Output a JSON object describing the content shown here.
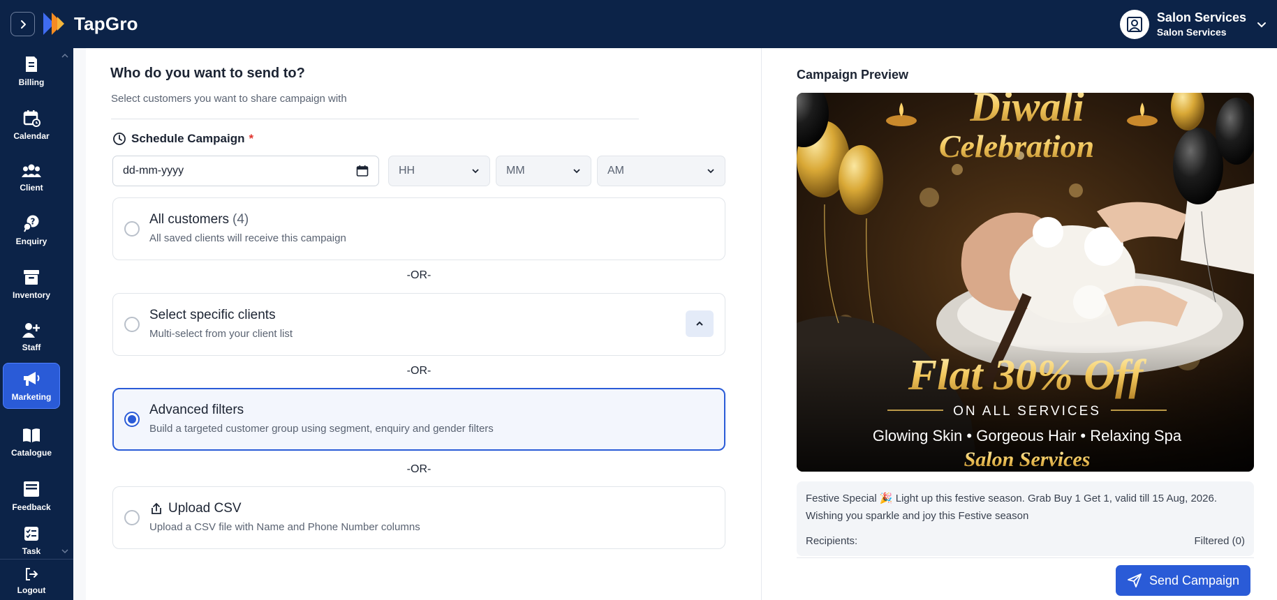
{
  "app": {
    "name": "TapGro"
  },
  "profile": {
    "name": "Salon Services",
    "subtitle": "Salon Services"
  },
  "sidebar": {
    "items": [
      {
        "label": "Billing",
        "icon": "receipt-icon",
        "active": false
      },
      {
        "label": "Calendar",
        "icon": "calendar-icon",
        "active": false
      },
      {
        "label": "Client",
        "icon": "users-icon",
        "active": false
      },
      {
        "label": "Enquiry",
        "icon": "question-chat-icon",
        "active": false
      },
      {
        "label": "Inventory",
        "icon": "archive-box-icon",
        "active": false
      },
      {
        "label": "Staff",
        "icon": "add-user-icon",
        "active": false
      },
      {
        "label": "Marketing",
        "icon": "megaphone-icon",
        "active": true
      },
      {
        "label": "Catalogue",
        "icon": "open-book-icon",
        "active": false
      },
      {
        "label": "Feedback",
        "icon": "inbox-icon",
        "active": false
      },
      {
        "label": "Task",
        "icon": "checklist-icon",
        "active": false
      }
    ],
    "logout_label": "Logout"
  },
  "audience": {
    "title": "Who do you want to send to?",
    "subtitle": "Select customers you want to share campaign with",
    "schedule_label": "Schedule Campaign",
    "required_mark": "*",
    "date_placeholder": "dd-mm-yyyy",
    "hour": "HH",
    "minute": "MM",
    "meridiem": "AM",
    "or_label": "-OR-",
    "options": [
      {
        "title": "All customers",
        "count": "(4)",
        "description": "All saved clients will receive this campaign",
        "selected": false
      },
      {
        "title": "Select specific clients",
        "description": "Multi-select from your client list",
        "selected": false
      },
      {
        "title": "Advanced filters",
        "description": "Build a targeted customer group using segment, enquiry and gender filters",
        "selected": true
      },
      {
        "title": "Upload CSV",
        "description": "Upload a CSV file with Name and Phone Number columns",
        "selected": false
      }
    ]
  },
  "preview": {
    "title": "Campaign Preview",
    "banner": {
      "line1": "Diwali",
      "line2": "Celebration",
      "offer": "Flat 30% Off",
      "offer_sub": "ON ALL SERVICES",
      "services": "Glowing Skin • Gorgeous Hair • Relaxing Spa",
      "brand": "Salon Services"
    },
    "message": "Festive Special 🎉 Light up this festive season. Grab Buy 1 Get 1, valid till 15 Aug, 2026. Wishing you sparkle and joy this Festive season",
    "recipients_label": "Recipients:",
    "recipients_value": "Filtered (0)",
    "send_label": "Send Campaign"
  },
  "colors": {
    "navy": "#0c2348",
    "accent": "#2a5bd7",
    "gold": "#f2c75c"
  }
}
